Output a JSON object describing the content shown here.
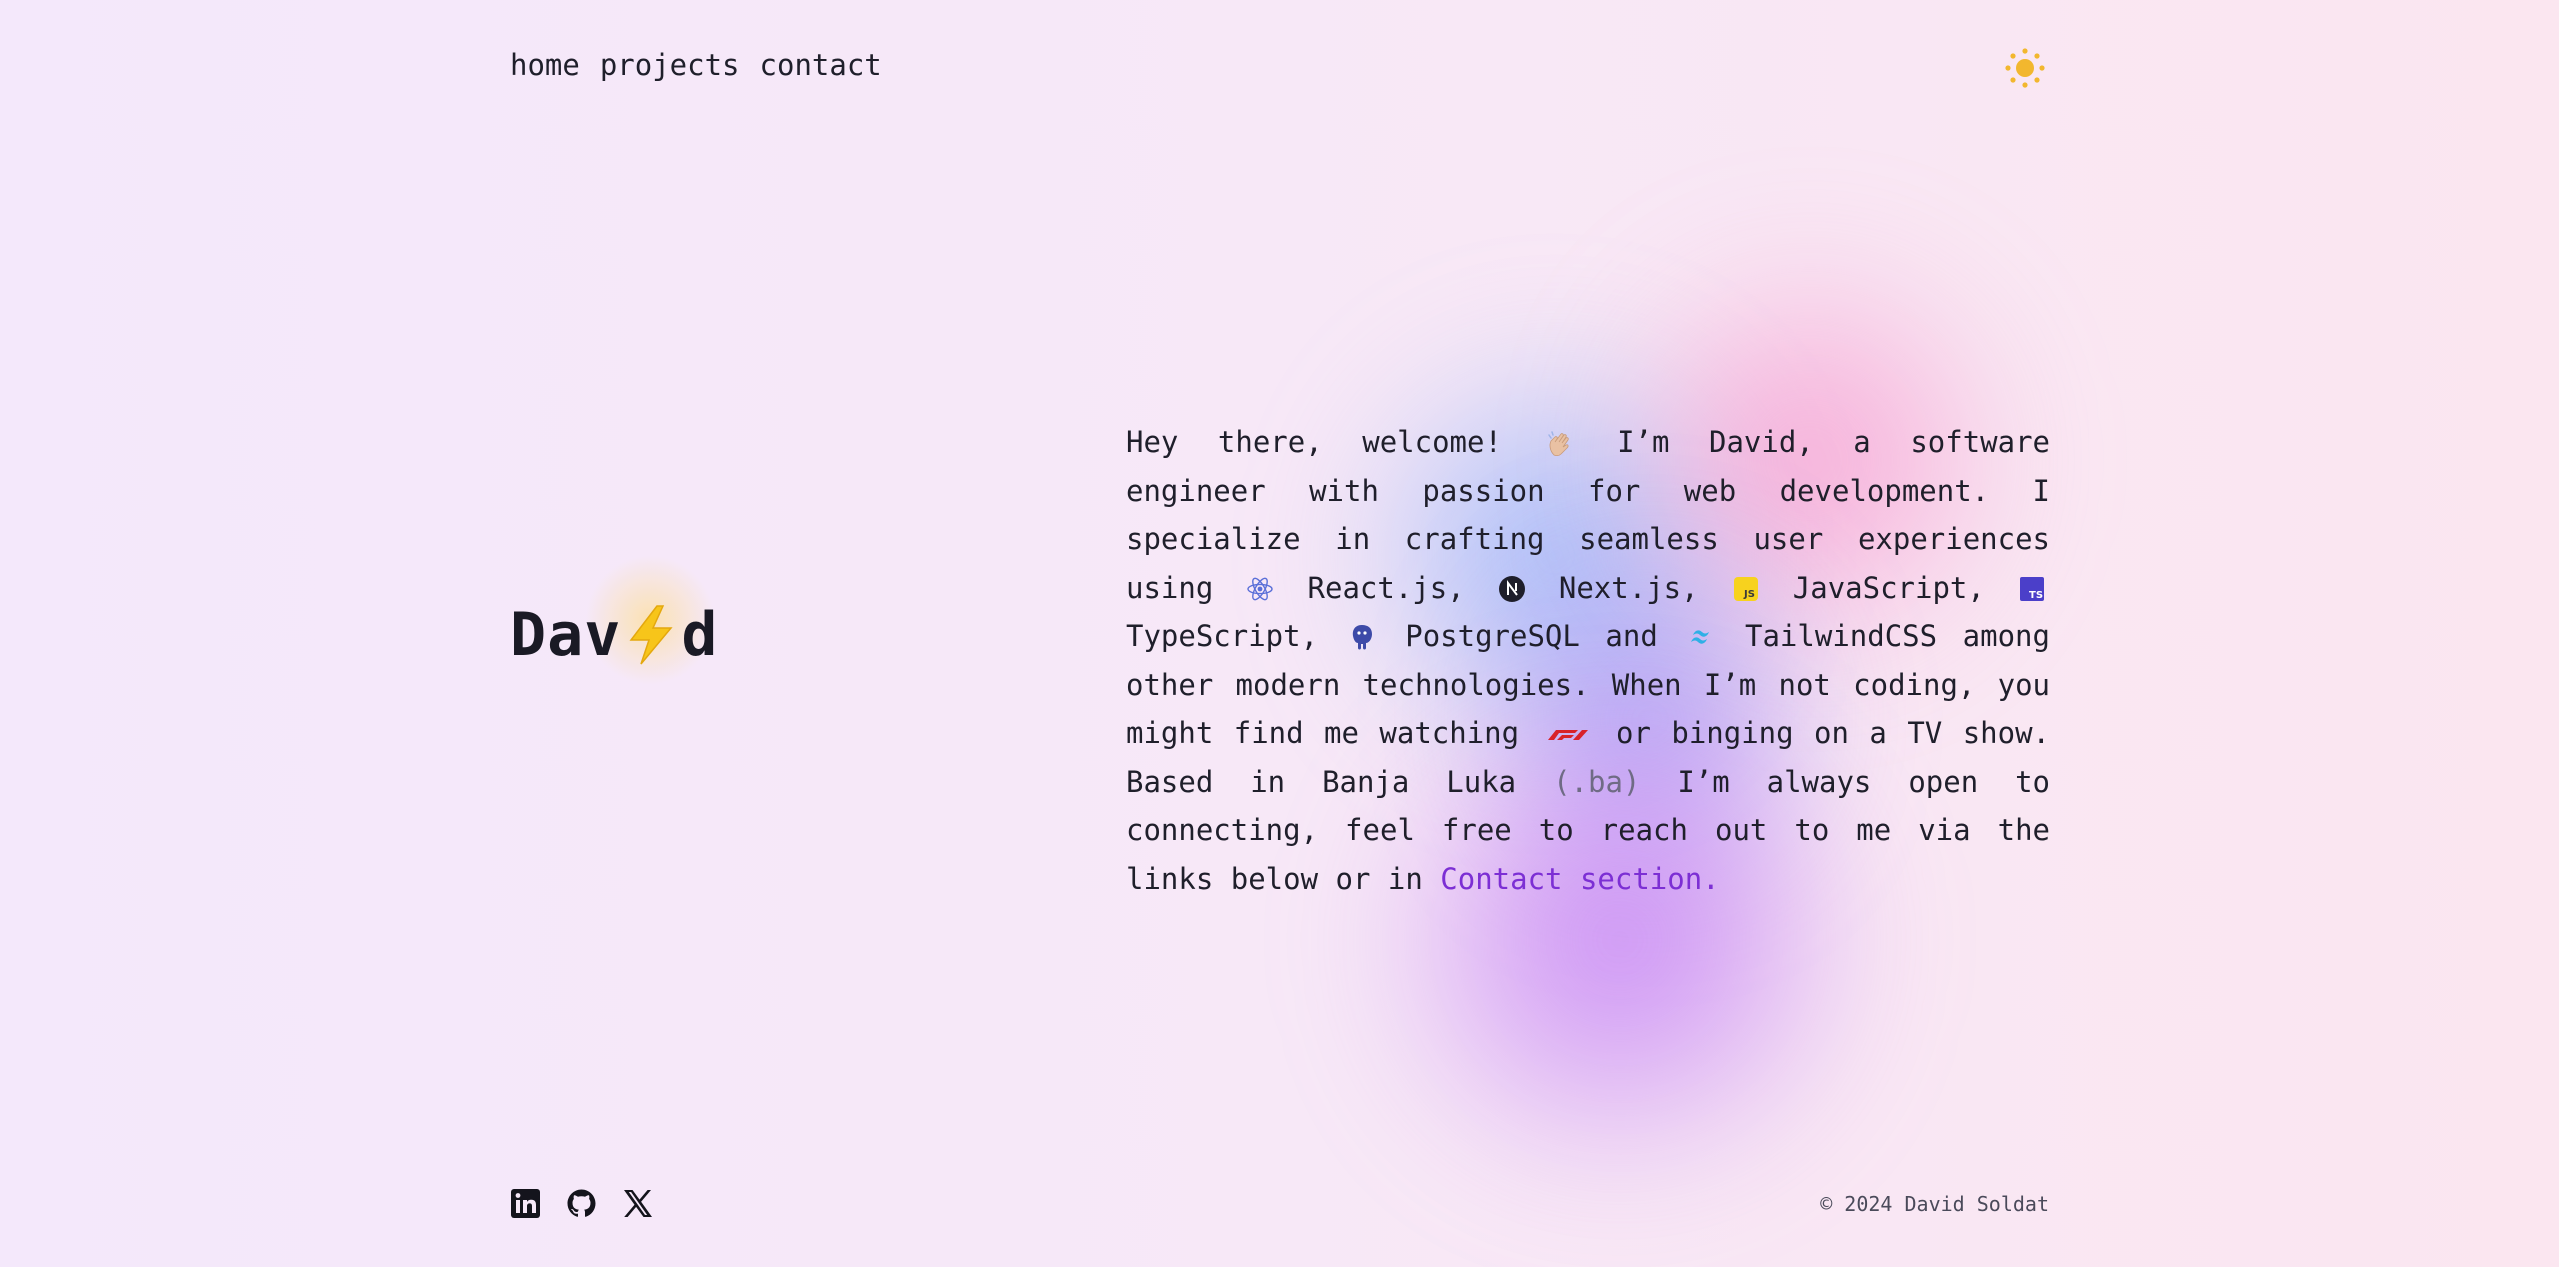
{
  "nav": {
    "items": [
      "home",
      "projects",
      "contact"
    ]
  },
  "theme_toggle": {
    "icon": "sun-icon",
    "color": "#f2b72e"
  },
  "logo": {
    "before": "Dav",
    "after": "d",
    "icon": "lightning-bolt-icon"
  },
  "bio": {
    "t1": "Hey there, welcome!",
    "t2": "I’m David, a software engineer with passion for web development. I specialize in crafting seamless user experiences using",
    "react": "React.js,",
    "next": "Next.js,",
    "js": "JavaScript,",
    "ts": "TypeScript,",
    "pg": "PostgreSQL and",
    "tw": "TailwindCSS",
    "t3": "among other modern technologies. When I’m not coding, you might find me watching",
    "t4": "or binging on a TV show. Based in Banja Luka",
    "ba": "(.ba)",
    "t5": "I’m always open to connecting, feel free to reach out to me via the links below or in",
    "contact_link": "Contact section."
  },
  "footer": {
    "socials": [
      "linkedin-icon",
      "github-icon",
      "x-icon"
    ],
    "copyright": "© 2024 David Soldat"
  },
  "colors": {
    "accent": "#7c2fd4",
    "text": "#1f1f2b"
  }
}
